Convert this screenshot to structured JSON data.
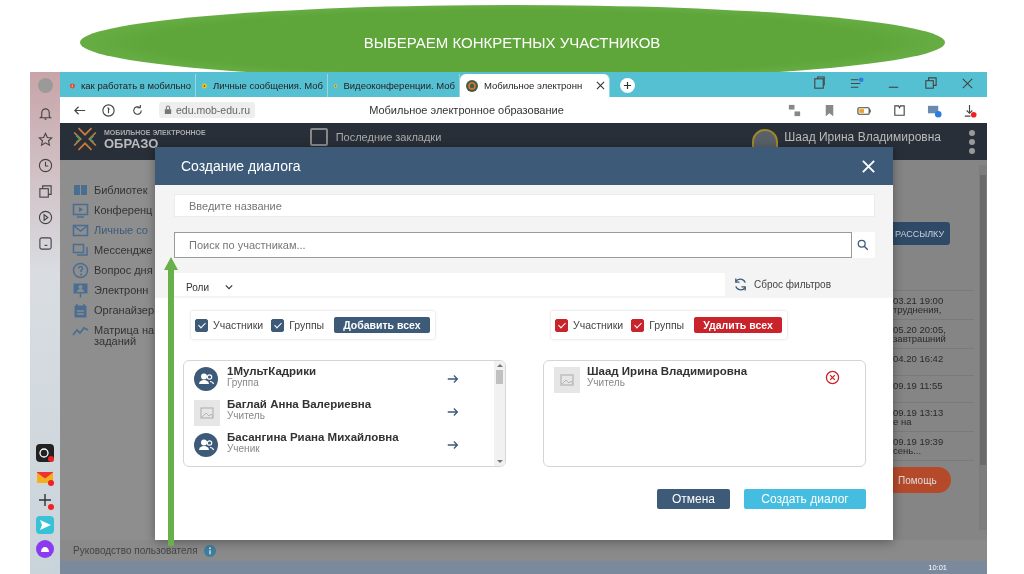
{
  "slide_title": "ВЫБЕРАЕМ КОНКРЕТНЫХ УЧАСТНИКОВ",
  "browser": {
    "tabs": [
      {
        "label": "как работать в мобильно",
        "selected": false,
        "kind": "search"
      },
      {
        "label": "Личные сообщения. Моб",
        "selected": false,
        "kind": "video"
      },
      {
        "label": "Видеоконференции. Моб",
        "selected": false,
        "kind": "video"
      },
      {
        "label": "Мобильное электронн",
        "selected": true,
        "kind": "site"
      }
    ],
    "url": "edu.mob-edu.ru",
    "page_title": "Мобильное электронное образование"
  },
  "app": {
    "logo_small": "МОБИЛЬНОЕ ЭЛЕКТРОННОЕ",
    "logo_big": "ОБРАЗО",
    "bookmarks": "Последние закладки",
    "user": "Шаад Ирина Владимировна",
    "menu": [
      {
        "label": "Библиотек",
        "selected": false
      },
      {
        "label": "Конференц",
        "selected": false
      },
      {
        "label": "Личные со",
        "selected": true
      },
      {
        "label": "Мессендже",
        "selected": false
      },
      {
        "label": "Вопрос дня",
        "selected": false
      },
      {
        "label": "Электронн",
        "selected": false
      },
      {
        "label": "Органайзер",
        "selected": false
      },
      {
        "label": "Матрица на заданий",
        "selected": false
      }
    ],
    "broadcast_button": "РАССЫЛКУ",
    "rows": [
      {
        "date": "03.21 19:00",
        "text": "труднения,"
      },
      {
        "date": "05.20 20:05,",
        "text": "завтрашний"
      },
      {
        "date": "04.20 16:42"
      },
      {
        "date": "09.19 11:55"
      },
      {
        "date": "09.19 13:13",
        "text": "е на"
      },
      {
        "date": "09.19 19:39",
        "text": "сень..."
      }
    ],
    "help_button": "Помощь",
    "guide": "Руководство пользователя",
    "clock": "10:01"
  },
  "dialog": {
    "title": "Создание диалога",
    "name_placeholder": "Введите название",
    "search_placeholder": "Поиск по участникам...",
    "roles_label": "Роли",
    "reset_label": "Сброс фильтров",
    "available": {
      "filters": [
        {
          "label": "Участники",
          "checked": true
        },
        {
          "label": "Группы",
          "checked": true
        }
      ],
      "action": "Добавить всех",
      "members": [
        {
          "kind": "group",
          "name": "1МультКадрики",
          "role": "Группа"
        },
        {
          "kind": "person",
          "name": "Баглай Анна Валериевна",
          "role": "Учитель"
        },
        {
          "kind": "group",
          "name": "Басангина Риана Михайловна",
          "role": "Ученик"
        }
      ]
    },
    "selected": {
      "filters": [
        {
          "label": "Участники",
          "checked": true
        },
        {
          "label": "Группы",
          "checked": true
        }
      ],
      "action": "Удалить всех",
      "members": [
        {
          "kind": "person",
          "name": "Шаад Ирина Владимировна",
          "role": "Учитель"
        }
      ]
    },
    "cancel_button": "Отмена",
    "create_button": "Создать диалог"
  }
}
